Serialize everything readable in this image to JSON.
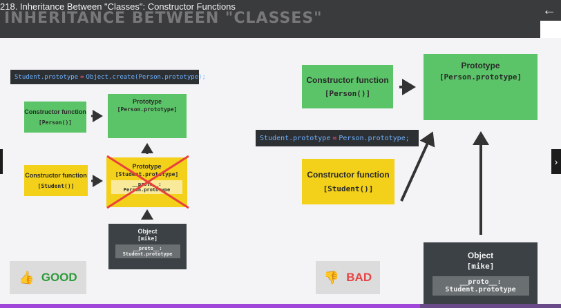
{
  "video": {
    "title": "218. Inheritance Between \"Classes\": Constructor Functions",
    "back_icon": "←",
    "next_icon": "›"
  },
  "slide": {
    "heading": "INHERITANCE BETWEEN \"CLASSES\""
  },
  "good": {
    "code": {
      "a": "Student.prototype",
      "op": "=",
      "b": "Object.create(Person.prototype);"
    },
    "person_ctor": {
      "title": "Constructor function",
      "code": "[Person()]"
    },
    "person_proto": {
      "title": "Prototype",
      "code": "[Person.prototype]"
    },
    "student_ctor": {
      "title": "Constructor function",
      "code": "[Student()]"
    },
    "student_proto": {
      "title": "Prototype",
      "code": "[Student.prototype]",
      "inner_a": "__proto__:",
      "inner_b": "Person.prototype"
    },
    "object": {
      "title": "Object",
      "code": "[mike]",
      "inner_a": "__proto__:",
      "inner_b": "Student.prototype"
    },
    "badge": {
      "icon": "👍",
      "label": "GOOD",
      "color": "#2e9a3a"
    }
  },
  "bad": {
    "code": {
      "a": "Student.prototype",
      "op": "=",
      "b": "Person.prototype;"
    },
    "person_ctor": {
      "title": "Constructor function",
      "code": "[Person()]"
    },
    "prototype": {
      "title": "Prototype",
      "code": "[Person.prototype]"
    },
    "student_ctor": {
      "title": "Constructor function",
      "code": "[Student()]"
    },
    "object": {
      "title": "Object",
      "code": "[mike]",
      "inner_a": "__proto__:",
      "inner_b": "Student.prototype"
    },
    "badge": {
      "icon": "👎",
      "label": "BAD",
      "color": "#e54545"
    }
  },
  "colors": {
    "green": "#5bc468",
    "yellow": "#f3d019",
    "dark": "#3b4144",
    "code_bg": "#2d3033",
    "cross": "#e8403d"
  }
}
